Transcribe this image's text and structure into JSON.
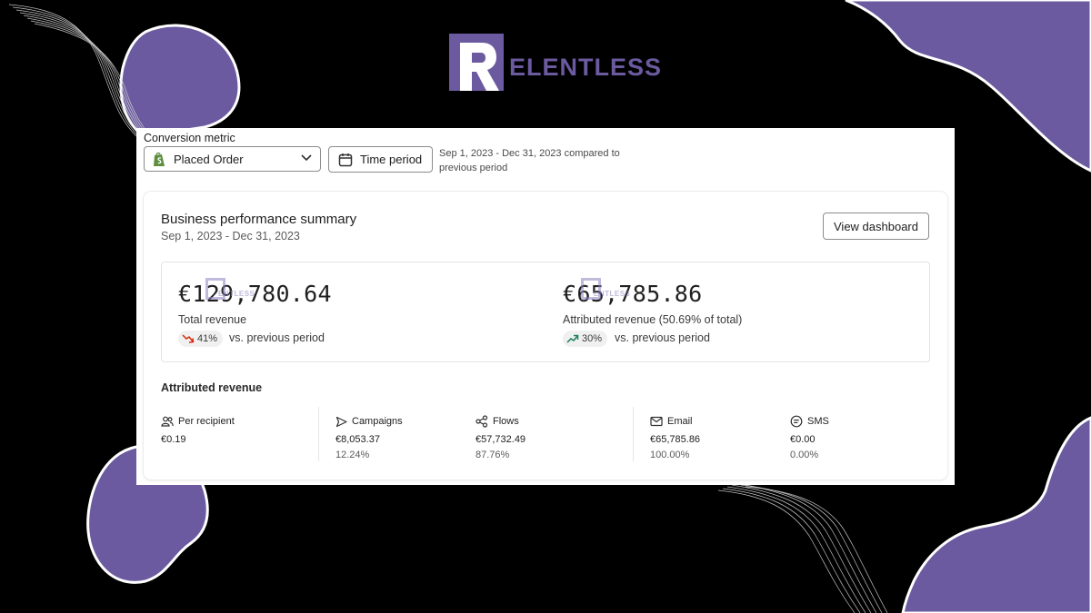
{
  "brand": {
    "logo_letter": "R",
    "logo_text": "ELENTLESS",
    "accent": "#6b5a9f"
  },
  "filters": {
    "conversion_metric_label": "Conversion metric",
    "selected_metric": "Placed Order",
    "time_period_button": "Time period",
    "comparison_text": "Sep 1, 2023 - Dec 31, 2023 compared to previous period"
  },
  "summary": {
    "title": "Business performance summary",
    "date_range": "Sep 1, 2023 - Dec 31, 2023",
    "view_dashboard_button": "View dashboard",
    "total_revenue": {
      "value": "€129,780.64",
      "label": "Total revenue",
      "change": "41%",
      "change_direction": "down",
      "change_color": "#d72c0d",
      "comparison": "vs. previous period"
    },
    "attributed_revenue": {
      "value": "€65,785.86",
      "label": "Attributed revenue (50.69% of total)",
      "change": "30%",
      "change_direction": "up",
      "change_color": "#1a7f5a",
      "comparison": "vs. previous period"
    }
  },
  "attributed": {
    "title": "Attributed revenue",
    "stats": [
      {
        "label": "Per recipient",
        "icon": "people-icon",
        "value": "€0.19",
        "pct": ""
      },
      {
        "label": "Campaigns",
        "icon": "send-icon",
        "value": "€8,053.37",
        "pct": "12.24%"
      },
      {
        "label": "Flows",
        "icon": "flows-icon",
        "value": "€57,732.49",
        "pct": "87.76%"
      },
      {
        "label": "Email",
        "icon": "mail-icon",
        "value": "€65,785.86",
        "pct": "100.00%"
      },
      {
        "label": "SMS",
        "icon": "sms-icon",
        "value": "€0.00",
        "pct": "0.00%"
      }
    ]
  }
}
